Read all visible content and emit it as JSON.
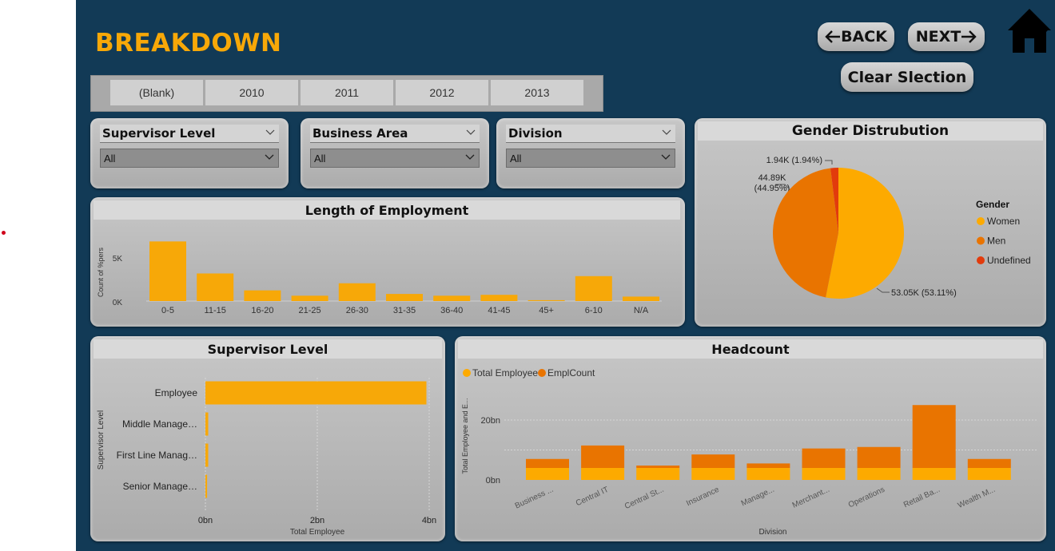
{
  "header": {
    "title": "BREAKDOWN",
    "back_label": "BACK",
    "next_label": "NEXT",
    "clear_label": "Clear Slection"
  },
  "icons": {
    "back": "arrow-left-icon",
    "next": "arrow-right-icon",
    "home": "home-icon",
    "dropdown": "chevron-down-icon"
  },
  "colors": {
    "background": "#123a56",
    "accent": "#f7a808",
    "orange": "#e97400",
    "red": "#e23b0c",
    "card": "#b5b5b5"
  },
  "years": [
    "(Blank)",
    "2010",
    "2011",
    "2012",
    "2013"
  ],
  "slicers": [
    {
      "label": "Supervisor Level",
      "value": "All"
    },
    {
      "label": "Business Area",
      "value": "All"
    },
    {
      "label": "Division",
      "value": "All"
    }
  ],
  "chart_data": [
    {
      "type": "bar",
      "title": "Length of Employment",
      "ylabel": "Count of %pers",
      "xlabel": "",
      "categories": [
        "0-5",
        "11-15",
        "16-20",
        "21-25",
        "26-30",
        "31-35",
        "36-40",
        "41-45",
        "45+",
        "6-10",
        "N/A"
      ],
      "values": [
        6700,
        3100,
        1200,
        600,
        2000,
        800,
        600,
        700,
        100,
        2800,
        500
      ],
      "yticks": [
        "5K",
        "0K"
      ],
      "ylim": [
        0,
        7000
      ]
    },
    {
      "type": "pie",
      "title": "Gender Distrubution",
      "legend_title": "Gender",
      "legend_position": "right",
      "slices": [
        {
          "name": "Women",
          "value": 53.11,
          "label": "53.05K (53.11%)",
          "color": "#fdaa00"
        },
        {
          "name": "Men",
          "value": 44.95,
          "label_line1": "44.89K",
          "label_line2": "(44.95%)",
          "color": "#e97400"
        },
        {
          "name": "Undefined",
          "value": 1.94,
          "label": "1.94K (1.94%)",
          "color": "#e23b0c"
        }
      ]
    },
    {
      "type": "bar",
      "orientation": "horizontal",
      "title": "Supervisor Level",
      "ylabel": "Supervisor Level",
      "xlabel": "Total Employee",
      "categories": [
        "Employee",
        "Middle Manage…",
        "First Line Manag…",
        "Senior Manage…"
      ],
      "values": [
        3.95,
        0.05,
        0.05,
        0.03
      ],
      "xticks": [
        "0bn",
        "2bn",
        "4bn"
      ],
      "xlim": [
        0,
        4
      ]
    },
    {
      "type": "bar",
      "stacked": true,
      "title": "Headcount",
      "ylabel": "Total Employee and E...",
      "xlabel": "Division",
      "categories": [
        "Business ...",
        "Central IT",
        "Central St...",
        "Insurance",
        "Manage...",
        "Merchant...",
        "Operations",
        "Retail Ba...",
        "Wealth M..."
      ],
      "series": [
        {
          "name": "Total Employee",
          "color": "#fdaa00",
          "values": [
            4,
            4,
            4,
            4,
            4,
            4,
            4,
            4,
            4
          ]
        },
        {
          "name": "EmplCount",
          "color": "#e97400",
          "values": [
            3,
            7.5,
            0.8,
            4.5,
            1.5,
            6.5,
            7,
            21,
            3
          ]
        }
      ],
      "yticks": [
        "20bn",
        "0bn"
      ],
      "ylim": [
        0,
        26
      ]
    }
  ]
}
